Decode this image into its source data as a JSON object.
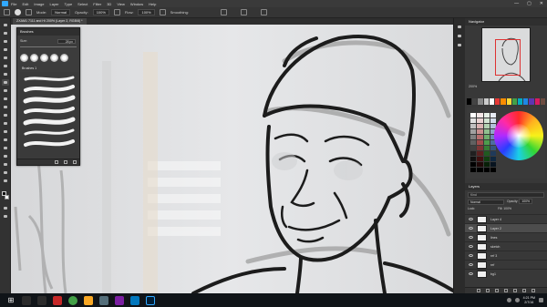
{
  "app": {
    "menu": [
      "File",
      "Edit",
      "Image",
      "Layer",
      "Type",
      "Select",
      "Filter",
      "3D",
      "View",
      "Window",
      "Help"
    ],
    "window_controls": [
      "—",
      "▢",
      "✕"
    ]
  },
  "options_bar": {
    "mode_label": "Mode:",
    "mode_value": "Normal",
    "opacity_label": "Opacity:",
    "opacity_value": "100%",
    "flow_label": "Flow:",
    "flow_value": "100%",
    "smoothing_label": "Smoothing:"
  },
  "document": {
    "tab_title": "ZXAM1 7111 and Hi 200% (Layer 2, RGB/8) *"
  },
  "brushes_panel": {
    "title": "Brushes",
    "size_label": "Size:",
    "size_value": "28 px",
    "folder_name": "Brushes 1"
  },
  "navigator": {
    "tab": "Navigator",
    "zoom": "200%"
  },
  "layers_panel": {
    "tab": "Layers",
    "search_placeholder": "Kind",
    "blend_mode": "Normal",
    "opacity_label": "Opacity:",
    "opacity_value": "100%",
    "lock_label": "Lock:",
    "fill_label": "Fill:",
    "fill_value": "100%",
    "layers": [
      {
        "name": "Layer 4",
        "selected": false
      },
      {
        "name": "Layer 2",
        "selected": true
      },
      {
        "name": "lines",
        "selected": false
      },
      {
        "name": "sketch",
        "selected": false
      },
      {
        "name": "ref 3",
        "selected": false
      },
      {
        "name": "ref",
        "selected": false
      },
      {
        "name": "bg1",
        "selected": false
      }
    ]
  },
  "swatch_colors": [
    "#000000",
    "#444444",
    "#888888",
    "#cccccc",
    "#ffffff",
    "#e53935",
    "#fb8c00",
    "#fdd835",
    "#43a047",
    "#00acc1",
    "#1e88e5",
    "#5e35b1",
    "#d81b60",
    "#6d4c41"
  ],
  "taskbar": {
    "time": "4:21 PM",
    "date": "2/7/16"
  }
}
